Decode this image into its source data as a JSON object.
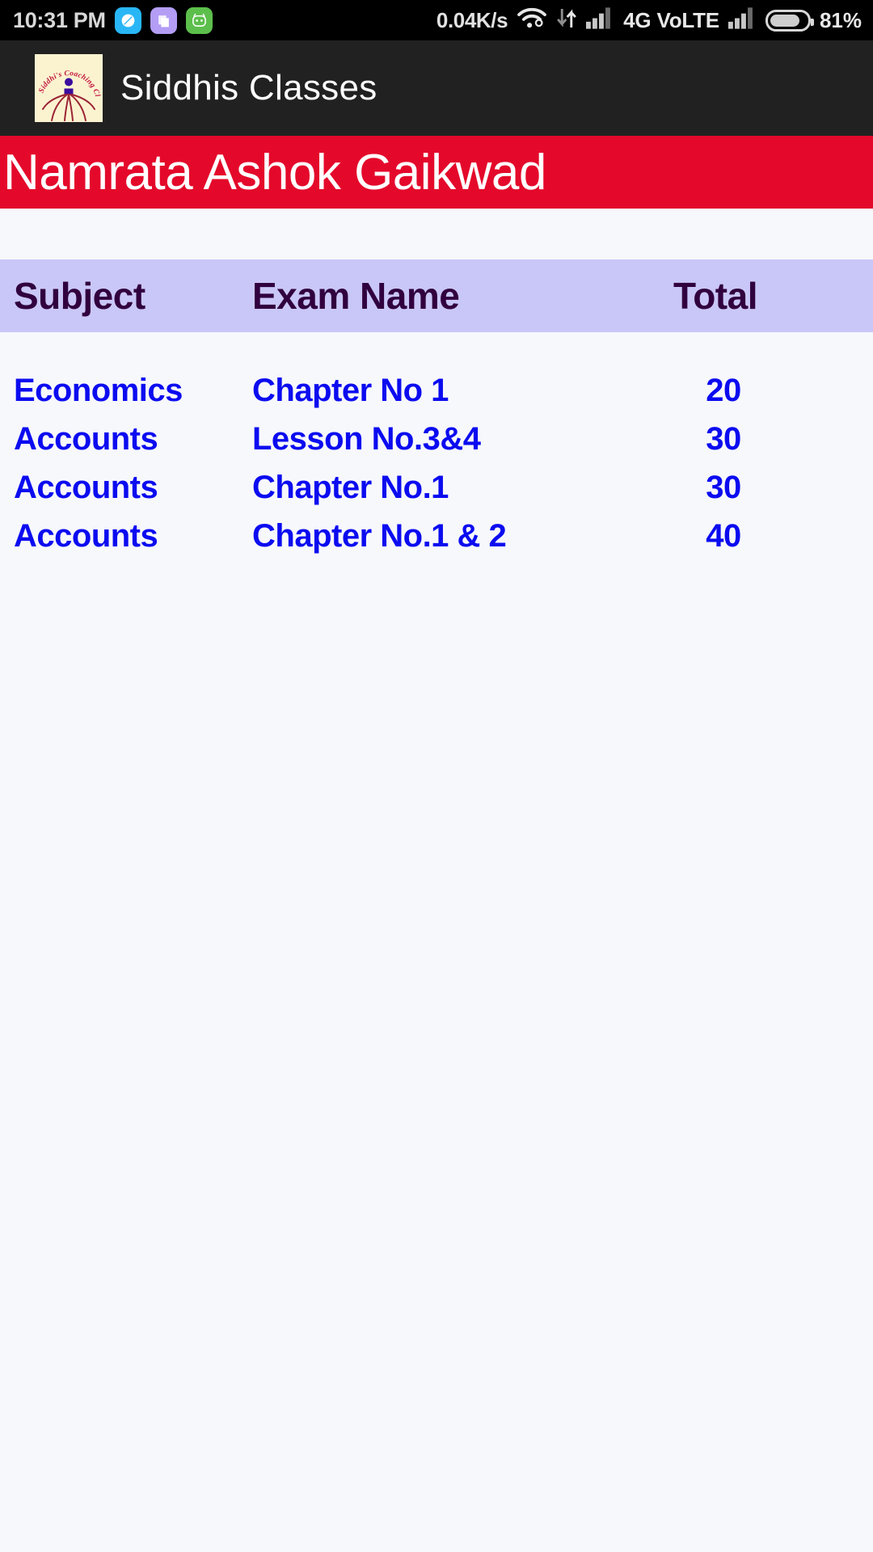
{
  "status_bar": {
    "time": "10:31 PM",
    "network_speed": "0.04K/s",
    "network_type": "4G VoLTE",
    "battery_percent": "81%",
    "app_icons": [
      {
        "name": "browser-icon",
        "color": "#29B6F6"
      },
      {
        "name": "notes-icon",
        "color": "#B39DF5"
      },
      {
        "name": "android-mascot-icon",
        "color": "#5CBF4B"
      }
    ],
    "icons": [
      "wifi-icon",
      "data-transfer-icon",
      "signal-bars-icon",
      "signal-bars-icon-2",
      "battery-icon"
    ]
  },
  "app_bar": {
    "title": "Siddhis Classes",
    "logo_text": "Siddhi's Coaching Classes",
    "logo_bg": "#FBF3D0",
    "bar_bg": "#212121"
  },
  "name_banner": {
    "student_name": "Namrata Ashok Gaikwad",
    "bg_color": "#E4092B",
    "text_color": "#FFFFFF"
  },
  "table": {
    "header_bg": "#C9C7F7",
    "header_text_color": "#31003E",
    "row_text_color": "#0B0BF0",
    "columns": [
      "Subject",
      "Exam Name",
      "Total"
    ],
    "rows": [
      {
        "subject": "Economics",
        "exam_name": "Chapter No 1",
        "total": "20"
      },
      {
        "subject": "Accounts",
        "exam_name": "Lesson No.3&4",
        "total": "30"
      },
      {
        "subject": "Accounts",
        "exam_name": "Chapter No.1",
        "total": "30"
      },
      {
        "subject": "Accounts",
        "exam_name": "Chapter No.1 & 2",
        "total": "40"
      }
    ]
  }
}
